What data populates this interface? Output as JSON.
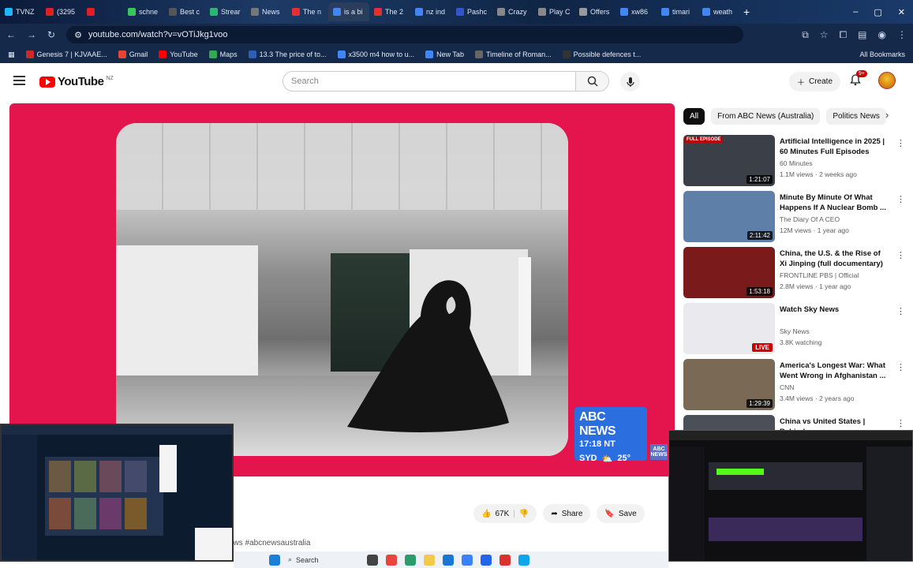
{
  "browser": {
    "tabs": [
      {
        "label": "TVNZ",
        "color": "#1fb6ff"
      },
      {
        "label": "(3295",
        "color": "#e02020"
      },
      {
        "label": "",
        "color": "#e02020"
      },
      {
        "label": "schne",
        "color": "#34c759"
      },
      {
        "label": "Best c",
        "color": "#555555"
      },
      {
        "label": "Strear",
        "color": "#2bb673"
      },
      {
        "label": "News",
        "color": "#777777"
      },
      {
        "label": "The n",
        "color": "#e03030"
      },
      {
        "label": "is a bi",
        "color": "#4285f4"
      },
      {
        "label": "The 2",
        "color": "#e03030"
      },
      {
        "label": "nz ind",
        "color": "#4285f4"
      },
      {
        "label": "Pashc",
        "color": "#3355cc"
      },
      {
        "label": "Crazy",
        "color": "#888888"
      },
      {
        "label": "Play C",
        "color": "#888888"
      },
      {
        "label": "Offers",
        "color": "#999999"
      },
      {
        "label": "xw86",
        "color": "#4285f4"
      },
      {
        "label": "timari",
        "color": "#4285f4"
      },
      {
        "label": "weath",
        "color": "#4285f4"
      }
    ],
    "url": "youtube.com/watch?v=vOTiJkg1voo",
    "bookmarks": [
      {
        "label": "Genesis 7 | KJVAAE...",
        "color": "#cc2a2a"
      },
      {
        "label": "Gmail",
        "color": "#ea4335"
      },
      {
        "label": "YouTube",
        "color": "#ff0000"
      },
      {
        "label": "Maps",
        "color": "#34a853"
      },
      {
        "label": "13.3 The price of to...",
        "color": "#2f5fb3"
      },
      {
        "label": "x3500 m4 how to u...",
        "color": "#4285f4"
      },
      {
        "label": "New Tab",
        "color": "#4285f4"
      },
      {
        "label": "Timeline of Roman...",
        "color": "#666666"
      },
      {
        "label": "Possible defences t...",
        "color": "#333333"
      }
    ],
    "all_bookmarks": "All Bookmarks"
  },
  "youtube": {
    "logo_text": "YouTube",
    "country": "NZ",
    "search_placeholder": "Search",
    "create_label": "Create",
    "notif_count": "9+"
  },
  "video": {
    "news_brand": "ABC NEWS",
    "time": "17:18 NT",
    "weather": "SYD",
    "temp": "25°",
    "badge": "ABC NEWS",
    "hashtag": "ews #abcnewsaustralia"
  },
  "actions": {
    "likes": "67K",
    "share": "Share",
    "save": "Save"
  },
  "chips": [
    "All",
    "From ABC News (Australia)",
    "Politics News"
  ],
  "recommendations": [
    {
      "title": "Artificial Intelligence in 2025 | 60 Minutes Full Episodes",
      "channel": "60 Minutes",
      "meta": "1.1M views · 2 weeks ago",
      "duration": "1:21:07",
      "tag": "FULL EPISODE",
      "thumb": "#3a3f48"
    },
    {
      "title": "Minute By Minute Of What Happens If A Nuclear Bomb ...",
      "channel": "The Diary Of A CEO",
      "meta": "12M views · 1 year ago",
      "duration": "2:11:42",
      "tag": "",
      "thumb": "#5d7fa8"
    },
    {
      "title": "China, the U.S. & the Rise of Xi Jinping (full documentary) | ...",
      "channel": "FRONTLINE PBS | Official",
      "meta": "2.8M views · 1 year ago",
      "duration": "1:53:18",
      "tag": "",
      "thumb": "#7a1a1a"
    },
    {
      "title": "Watch Sky News",
      "channel": "Sky News",
      "meta": "3.8K watching",
      "duration": "LIVE",
      "tag": "",
      "thumb": "#e9e9ee"
    },
    {
      "title": "America's Longest War: What Went Wrong in Afghanistan ...",
      "channel": "CNN",
      "meta": "3.4M views · 2 years ago",
      "duration": "1:29:39",
      "tag": "",
      "thumb": "#7a6a55"
    },
    {
      "title": "China vs United States | Behind",
      "channel": "",
      "meta": "",
      "duration": "",
      "tag": "",
      "thumb": "#4a4f58"
    }
  ],
  "taskbar": {
    "search": "Search"
  }
}
